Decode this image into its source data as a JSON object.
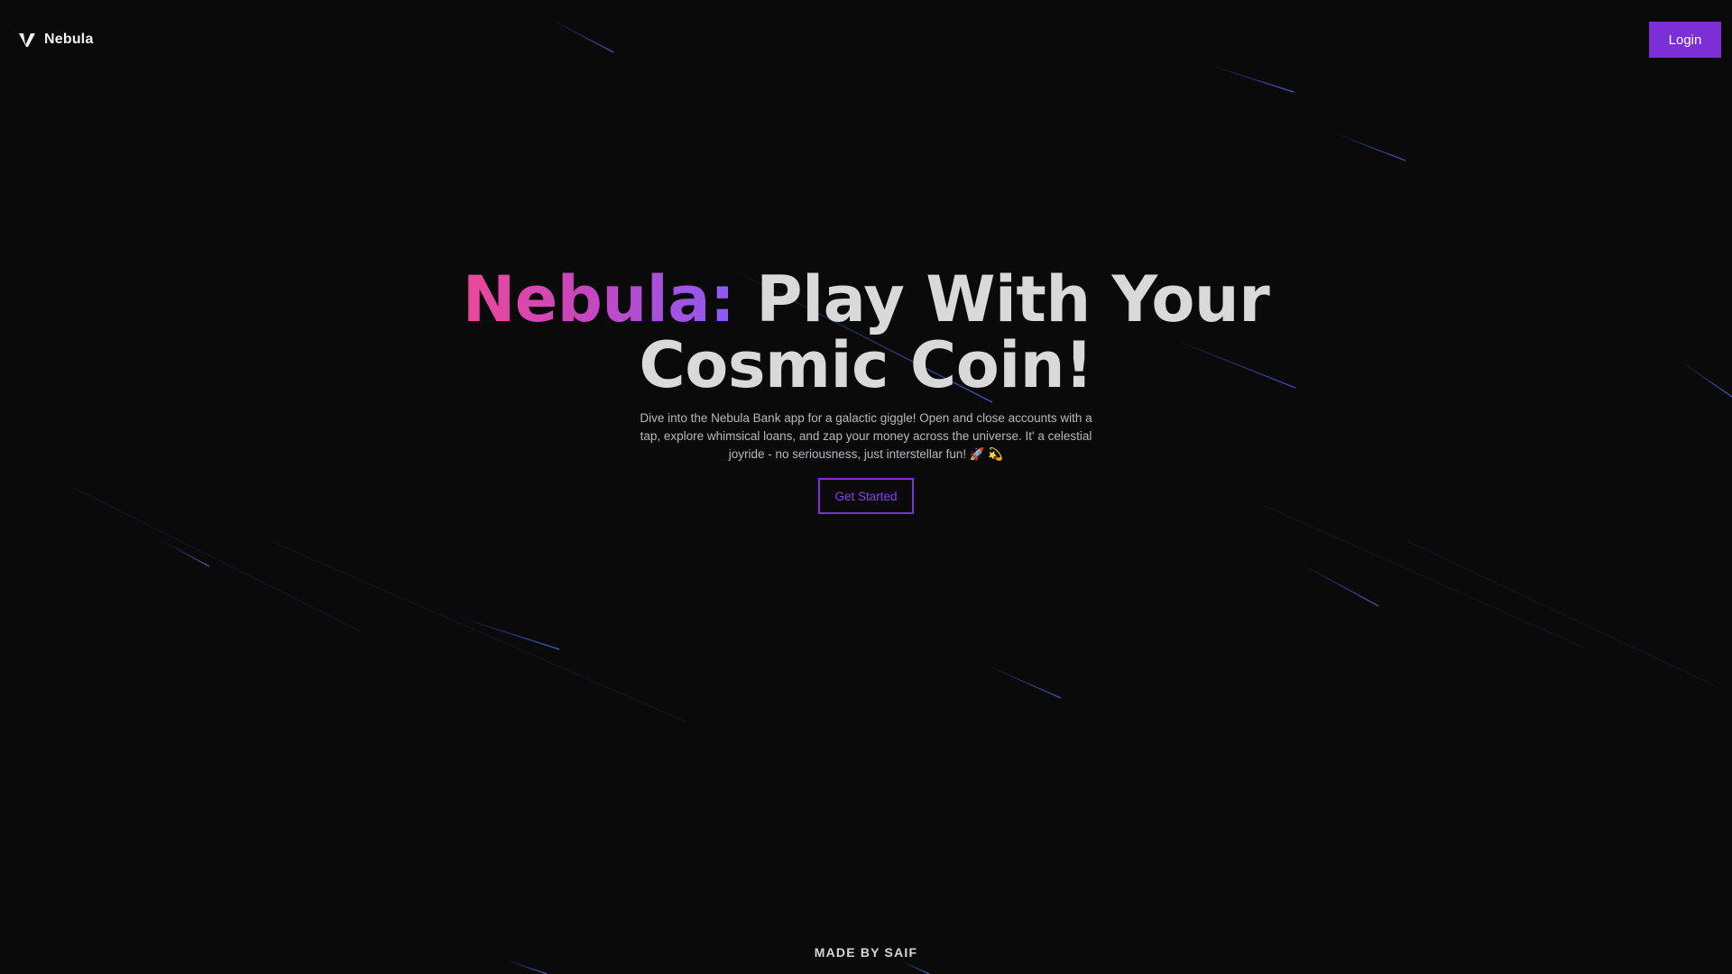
{
  "header": {
    "brand_name": "Nebula",
    "login_label": "Login"
  },
  "hero": {
    "title_highlight": "Nebula:",
    "title_rest": " Play With Your Cosmic Coin!",
    "description": "Dive into the Nebula Bank app for a galactic giggle! Open and close accounts with a tap, explore whimsical loans, and zap your money across the universe. It' a celestial joyride - no seriousness, just interstellar fun! 🚀 💫",
    "cta_label": "Get Started"
  },
  "footer": {
    "credit": "MADE BY SAIF"
  },
  "theme": {
    "background": "#0a0a0b",
    "accent": "#7b2fd4",
    "gradient_start": "#ec4899",
    "gradient_end": "#8b5cf6",
    "meteor_color": "#3b5bdb"
  },
  "icons": {
    "brand_logo": "v-logo-icon"
  }
}
